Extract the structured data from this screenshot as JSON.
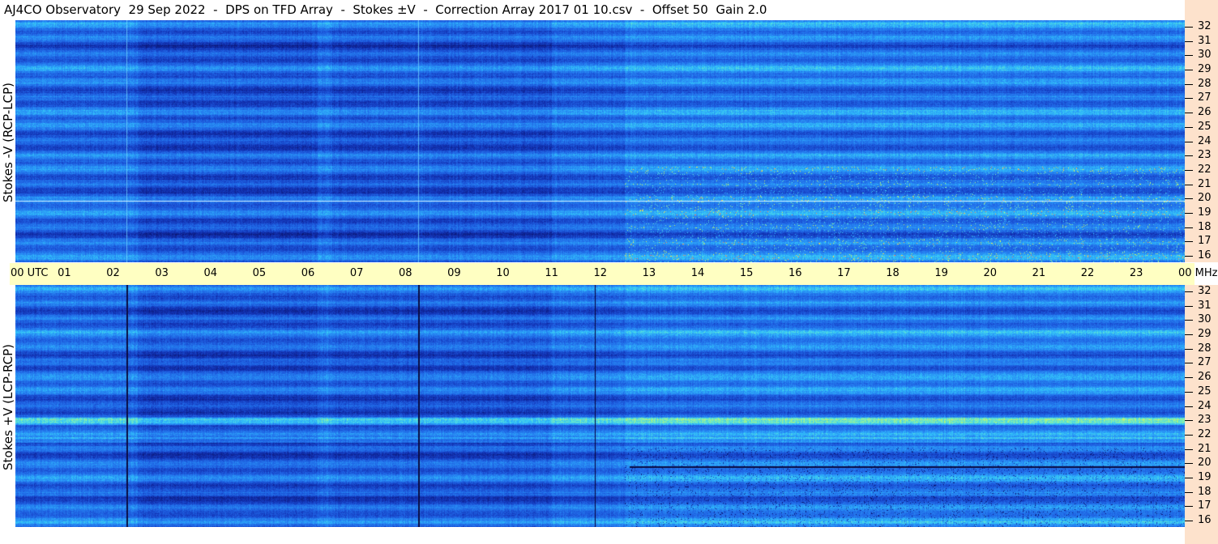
{
  "title": "AJ4CO Observatory  29 Sep 2022  -  DPS on TFD Array  -  Stokes ±V  -  Correction Array 2017 01 10.csv  -  Offset 50  Gain 2.0",
  "panels": [
    {
      "ylabel": "Stokes -V (RCP-LCP)"
    },
    {
      "ylabel": "Stokes +V (LCP-RCP)"
    }
  ],
  "time_axis": {
    "labels": [
      "00  UTC",
      "01",
      "02",
      "03",
      "04",
      "05",
      "06",
      "07",
      "08",
      "09",
      "10",
      "11",
      "12",
      "13",
      "14",
      "15",
      "16",
      "17",
      "18",
      "19",
      "20",
      "21",
      "22",
      "23",
      "00 MHz"
    ]
  },
  "freq_axis": {
    "labels": [
      "32",
      "31",
      "30",
      "29",
      "28",
      "27",
      "26",
      "25",
      "24",
      "23",
      "22",
      "21",
      "20",
      "19",
      "18",
      "17",
      "16"
    ]
  },
  "chart_data": [
    {
      "type": "heatmap",
      "title": "Stokes -V (RCP-LCP)",
      "xlabel": "UTC",
      "ylabel": "Stokes -V (RCP-LCP)",
      "x_ticks": [
        "00",
        "01",
        "02",
        "03",
        "04",
        "05",
        "06",
        "07",
        "08",
        "09",
        "10",
        "11",
        "12",
        "13",
        "14",
        "15",
        "16",
        "17",
        "18",
        "19",
        "20",
        "21",
        "22",
        "23",
        "00"
      ],
      "y_ticks_mhz": [
        32,
        31,
        30,
        29,
        28,
        27,
        26,
        25,
        24,
        23,
        22,
        21,
        20,
        19,
        18,
        17,
        16
      ],
      "xlim_hours": [
        0,
        24
      ],
      "ylim_mhz": [
        16,
        32
      ],
      "colormap": [
        "#0a1a8c",
        "#1a4fd6",
        "#2f8cf0",
        "#38d0ff",
        "#9ff06a",
        "#ffff40",
        "#ff8040",
        "#ff3030"
      ],
      "background_color": "#2a6fe0"
    },
    {
      "type": "heatmap",
      "title": "Stokes +V (LCP-RCP)",
      "xlabel": "UTC",
      "ylabel": "Stokes +V (LCP-RCP)",
      "x_ticks": [
        "00",
        "01",
        "02",
        "03",
        "04",
        "05",
        "06",
        "07",
        "08",
        "09",
        "10",
        "11",
        "12",
        "13",
        "14",
        "15",
        "16",
        "17",
        "18",
        "19",
        "20",
        "21",
        "22",
        "23",
        "00"
      ],
      "y_ticks_mhz": [
        32,
        31,
        30,
        29,
        28,
        27,
        26,
        25,
        24,
        23,
        22,
        21,
        20,
        19,
        18,
        17,
        16
      ],
      "xlim_hours": [
        0,
        24
      ],
      "ylim_mhz": [
        16,
        32
      ],
      "colormap": [
        "#0a1a8c",
        "#1a4fd6",
        "#2f8cf0",
        "#38d0ff",
        "#9ff06a",
        "#ffff40"
      ],
      "background_color": "#2a6fe0"
    }
  ],
  "colors": {
    "axis_band": "#ffffc2",
    "freq_strip": "#fde2cc"
  }
}
